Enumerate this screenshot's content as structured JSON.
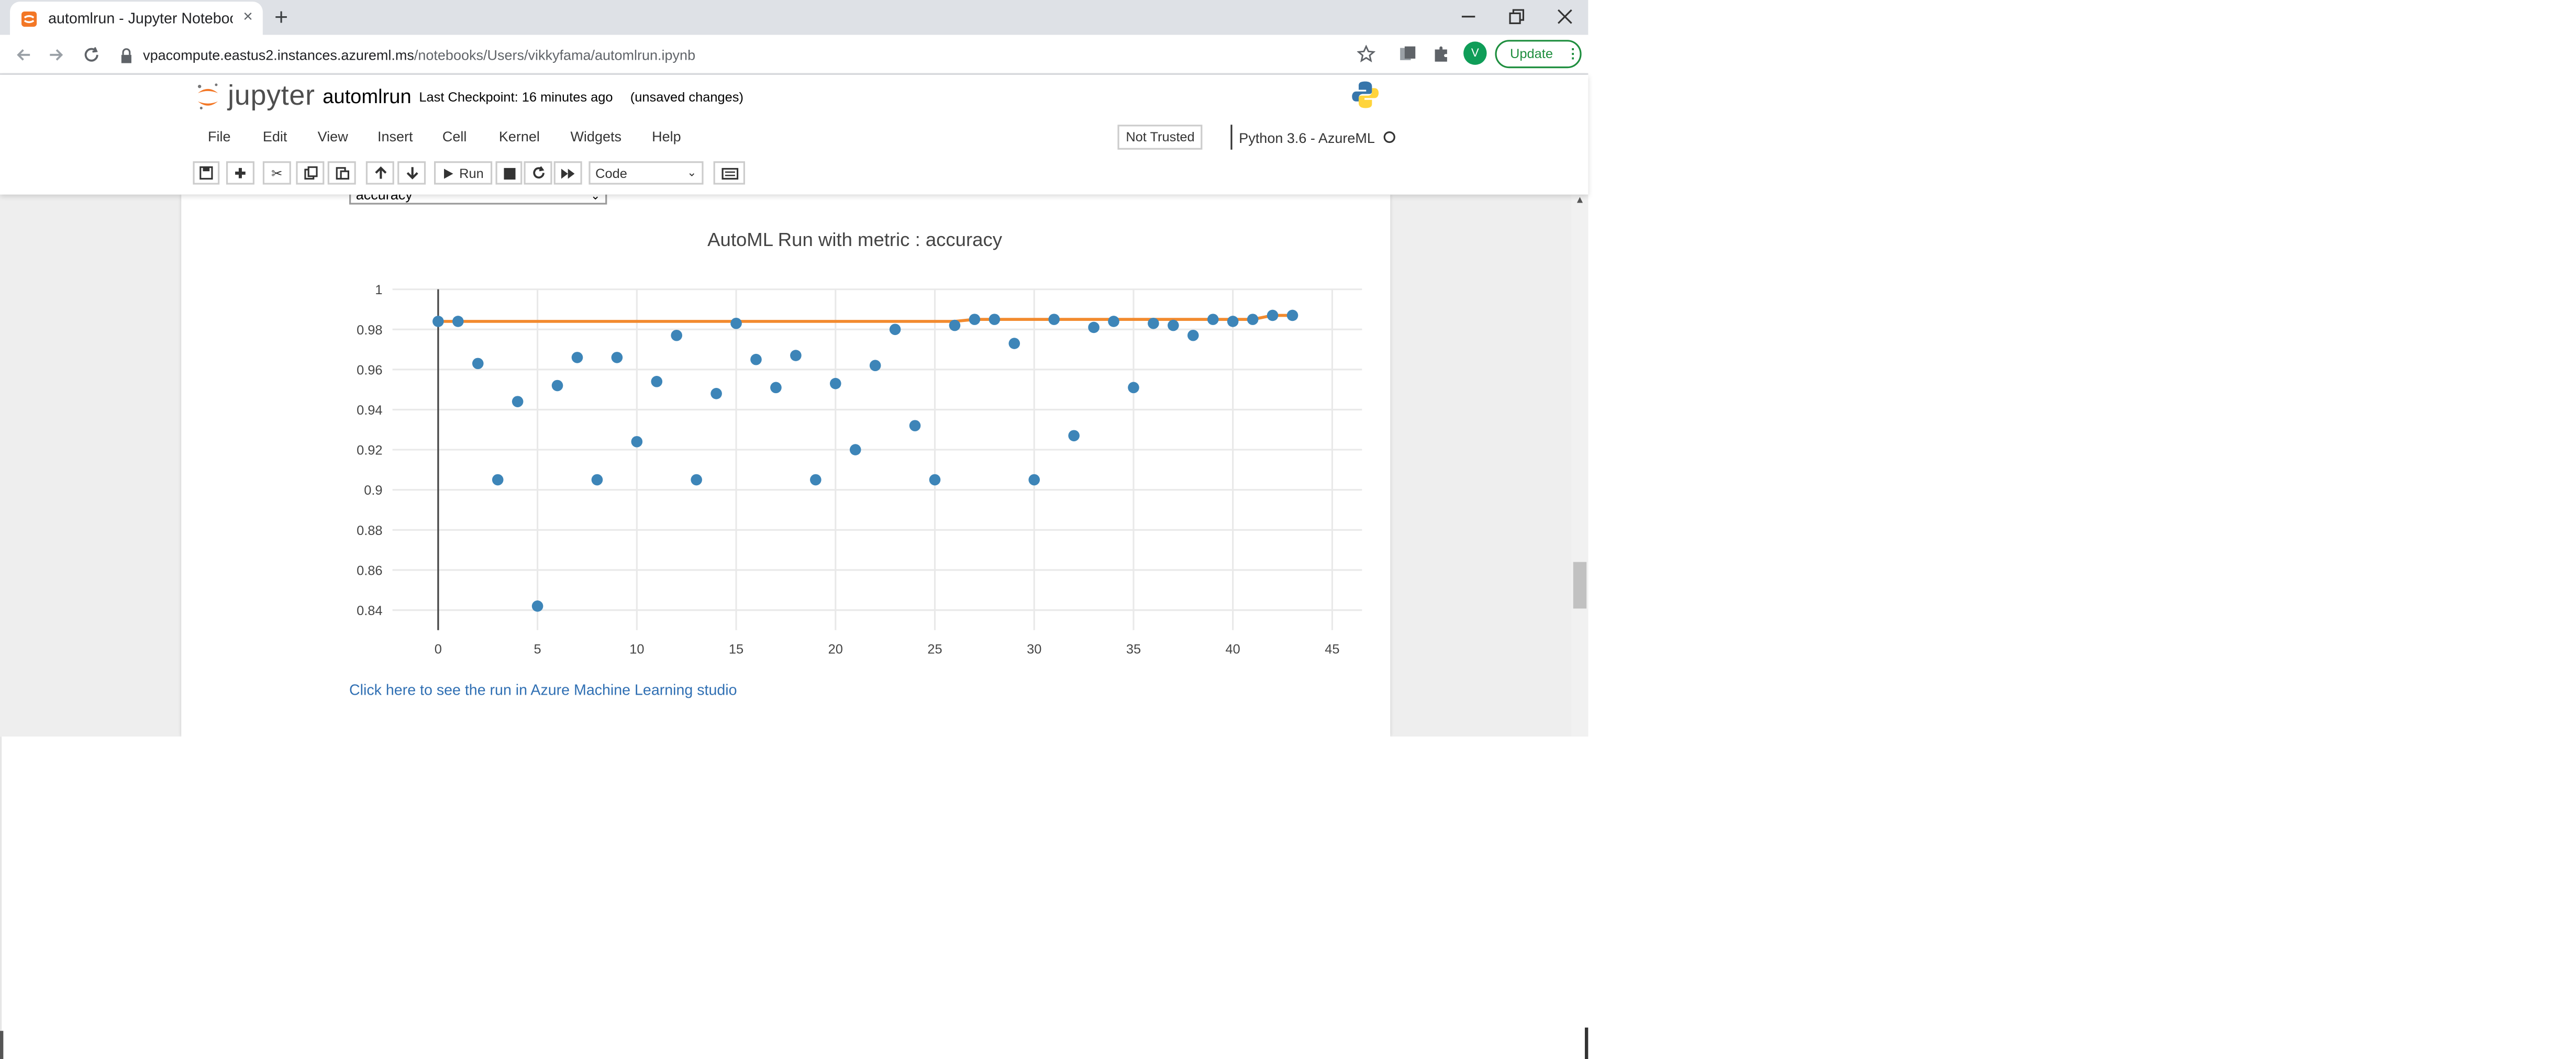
{
  "browser": {
    "tab_title": "automlrun - Jupyter Notebook",
    "tab_close": "×",
    "new_tab": "+",
    "url_host": "vpacompute.eastus2.instances.azureml.ms",
    "url_path": "/notebooks/Users/vikkyfama/automlrun.ipynb",
    "avatar_letter": "V",
    "update_label": "Update"
  },
  "jupyter": {
    "logo_text": "jupyter",
    "notebook_name": "automlrun",
    "checkpoint": "Last Checkpoint: 16 minutes ago",
    "unsaved": "(unsaved changes)",
    "menu": [
      "File",
      "Edit",
      "View",
      "Insert",
      "Cell",
      "Kernel",
      "Widgets",
      "Help"
    ],
    "trust_status": "Not Trusted",
    "kernel_name": "Python 3.6 - AzureML",
    "run_label": "Run",
    "cell_type": "Code"
  },
  "notebook": {
    "metric_select_value": "accuracy",
    "run_link": "Click here to see the run in Azure Machine Learning studio"
  },
  "chart_data": {
    "type": "scatter",
    "title": "AutoML Run with metric : accuracy",
    "xlabel": "",
    "ylabel": "",
    "xlim": [
      -2.3,
      46.5
    ],
    "ylim": [
      0.83,
      1.0
    ],
    "xticks": [
      0,
      5,
      10,
      15,
      20,
      25,
      30,
      35,
      40,
      45
    ],
    "yticks": [
      0.84,
      0.86,
      0.88,
      0.9,
      0.92,
      0.94,
      0.96,
      0.98,
      1
    ],
    "grid": true,
    "legend": "none",
    "colors": {
      "points": "#3d85b8",
      "best_line": "#f28a2e",
      "axis": "#444444",
      "grid": "#e9e9e9"
    },
    "series": [
      {
        "kind": "points",
        "x": [
          0,
          1,
          2,
          3,
          4,
          5,
          6,
          7,
          8,
          9,
          10,
          11,
          12,
          13,
          14,
          15,
          16,
          17,
          18,
          19,
          20,
          21,
          22,
          23,
          24,
          25,
          26,
          27,
          28,
          29,
          30,
          31,
          32,
          33,
          34,
          35,
          36,
          37,
          38,
          39,
          40,
          41,
          42,
          43
        ],
        "y": [
          0.984,
          0.984,
          0.963,
          0.905,
          0.944,
          0.842,
          0.952,
          0.966,
          0.905,
          0.966,
          0.924,
          0.954,
          0.977,
          0.905,
          0.948,
          0.983,
          0.965,
          0.951,
          0.967,
          0.905,
          0.953,
          0.92,
          0.962,
          0.98,
          0.932,
          0.905,
          0.982,
          0.985,
          0.985,
          0.973,
          0.905,
          0.985,
          0.927,
          0.981,
          0.984,
          0.951,
          0.983,
          0.982,
          0.977,
          0.985,
          0.984,
          0.985,
          0.987,
          0.987
        ]
      },
      {
        "kind": "line",
        "x": [
          0,
          1,
          2,
          3,
          4,
          5,
          6,
          7,
          8,
          9,
          10,
          11,
          12,
          13,
          14,
          15,
          16,
          17,
          18,
          19,
          20,
          21,
          22,
          23,
          24,
          25,
          26,
          27,
          28,
          29,
          30,
          31,
          32,
          33,
          34,
          35,
          36,
          37,
          38,
          39,
          40,
          41,
          42,
          43
        ],
        "y": [
          0.984,
          0.984,
          0.984,
          0.984,
          0.984,
          0.984,
          0.984,
          0.984,
          0.984,
          0.984,
          0.984,
          0.984,
          0.984,
          0.984,
          0.984,
          0.984,
          0.984,
          0.984,
          0.984,
          0.984,
          0.984,
          0.984,
          0.984,
          0.984,
          0.984,
          0.984,
          0.984,
          0.985,
          0.985,
          0.985,
          0.985,
          0.985,
          0.985,
          0.985,
          0.985,
          0.985,
          0.985,
          0.985,
          0.985,
          0.985,
          0.985,
          0.985,
          0.987,
          0.987
        ]
      }
    ]
  }
}
